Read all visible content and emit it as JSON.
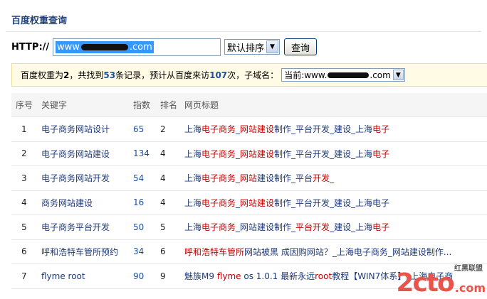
{
  "page": {
    "title": "百度权重查询"
  },
  "query": {
    "http_label": "HTTP://",
    "url_prefix": "www",
    "url_suffix": ".com",
    "sort_value": "默认排序",
    "submit_label": "查询"
  },
  "summary": {
    "t1": "百度权重为 ",
    "weight": "2",
    "t2": "，共找到 ",
    "records": "53",
    "t3": " 条记录，预计从百度来访 ",
    "visits": "107",
    "t4": " 次，子域名：",
    "domain_prefix": "当前:www.",
    "domain_suffix": ".com"
  },
  "table": {
    "headers": [
      "序号",
      "关键字",
      "指数",
      "排名",
      "网页标题"
    ],
    "rows": [
      {
        "idx": "1",
        "kw": "电子商务网站设计",
        "num": "65",
        "rank": "2",
        "title": [
          [
            "上海",
            ""
          ],
          [
            "电子商务",
            "red"
          ],
          [
            "_",
            ""
          ],
          [
            "网站建设",
            "red"
          ],
          [
            "制作_平台开发_建设_上海",
            ""
          ],
          [
            "电子",
            "red"
          ]
        ]
      },
      {
        "idx": "2",
        "kw": "电子商务网站建设",
        "num": "134",
        "rank": "4",
        "title": [
          [
            "上海",
            ""
          ],
          [
            "电子商务",
            "red"
          ],
          [
            "_",
            ""
          ],
          [
            "网站建设",
            "red"
          ],
          [
            "制作_平台开发_建设_上海",
            ""
          ],
          [
            "电子",
            "red"
          ]
        ]
      },
      {
        "idx": "3",
        "kw": "电子商务网站开发",
        "num": "54",
        "rank": "4",
        "title": [
          [
            "上海",
            ""
          ],
          [
            "电子商务",
            "red"
          ],
          [
            "_",
            ""
          ],
          [
            "网站",
            "red"
          ],
          [
            "建设制作_平台",
            ""
          ],
          [
            "开发",
            "red"
          ],
          [
            "_",
            ""
          ]
        ]
      },
      {
        "idx": "4",
        "kw": "商务网站建设",
        "num": "16",
        "rank": "4",
        "title": [
          [
            "上海",
            ""
          ],
          [
            "电子商务",
            "red"
          ],
          [
            "_",
            ""
          ],
          [
            "网站建设",
            "red"
          ],
          [
            "制作_平台开发_建设_上海电子",
            ""
          ]
        ]
      },
      {
        "idx": "5",
        "kw": "电子商务平台开发",
        "num": "50",
        "rank": "5",
        "title": [
          [
            "上海",
            ""
          ],
          [
            "电子商务",
            "red"
          ],
          [
            "_网站建设制作_",
            ""
          ],
          [
            "平台开发",
            "red"
          ],
          [
            "_建设_上海",
            ""
          ],
          [
            "电子",
            "red"
          ]
        ]
      },
      {
        "idx": "6",
        "kw": "呼和浩特车管所预约",
        "num": "34",
        "rank": "6",
        "title": [
          [
            "呼和浩特车管所",
            "red"
          ],
          [
            "网站被黑 成因购网站？_上海电子商务_网站建设制作...",
            ""
          ]
        ]
      },
      {
        "idx": "7",
        "kw": "flyme root",
        "num": "90",
        "rank": "9",
        "title": [
          [
            "魅族M9 ",
            ""
          ],
          [
            "flyme",
            "red"
          ],
          [
            " os 1.0.1 最新永远",
            ""
          ],
          [
            "root",
            "red"
          ],
          [
            "教程【WIN7体系】_上海电子商",
            ""
          ]
        ]
      }
    ]
  },
  "watermark": {
    "text": "2cto",
    "suffix": ".com",
    "tag": "红黑联盟"
  },
  "colors": {
    "title": "#1f3f78",
    "link": "#1f3a78",
    "keyword_red": "#c00000",
    "summary_bg": "#fffbe5",
    "header_bg": "#f5f5f5"
  }
}
